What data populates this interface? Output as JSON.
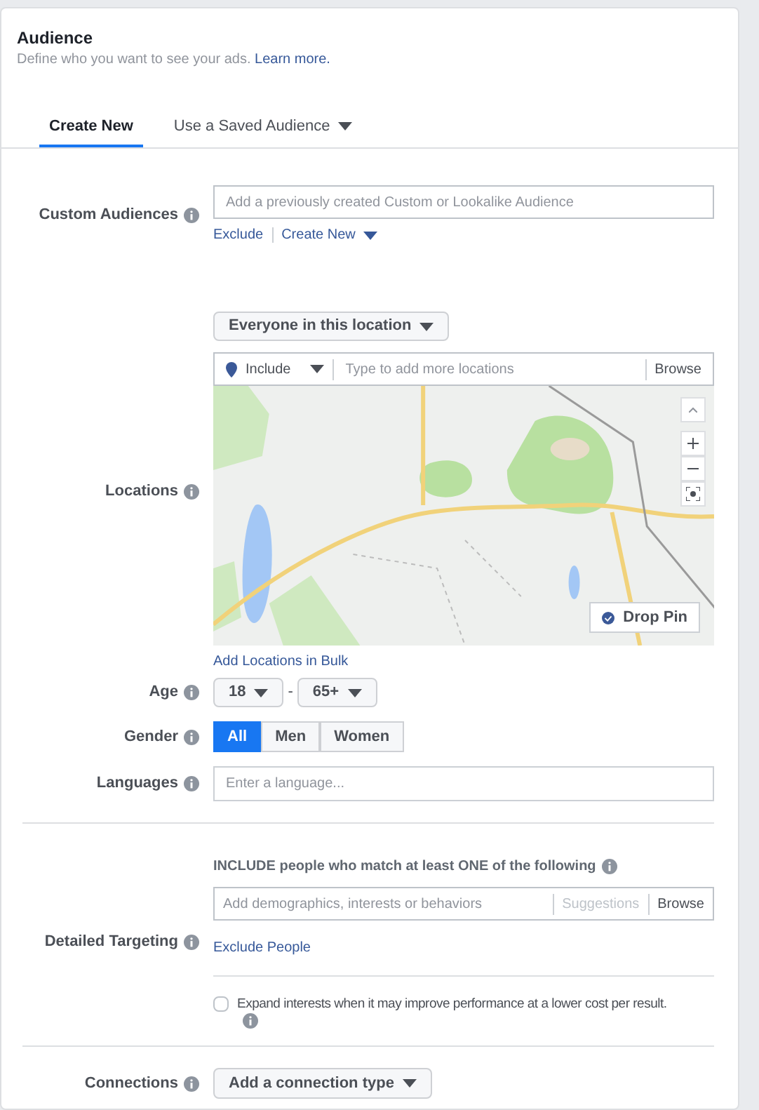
{
  "header": {
    "title": "Audience",
    "subtitle": "Define who you want to see your ads.",
    "link": "Learn more."
  },
  "tabs": [
    {
      "label": "Create New",
      "selected": true,
      "kind": "plain"
    },
    {
      "label": "Use a Saved Audience",
      "selected": false,
      "kind": "dropdown"
    }
  ],
  "custom_audiences": {
    "label": "Custom Audiences",
    "placeholder": "Add a previously created Custom or Lookalike Audience",
    "links": [
      {
        "label": "Exclude",
        "kind": "plain"
      },
      {
        "label": "Create New",
        "kind": "dropdown"
      }
    ]
  },
  "locations": {
    "label": "Locations",
    "audience_dropdown": "Everyone in this location",
    "include_dropdown": "Include",
    "placeholder": "Type to add more locations",
    "browse": "Browse",
    "drop_pin": "Drop Pin",
    "bulk_link": "Add Locations in Bulk"
  },
  "age": {
    "label": "Age",
    "min": "18",
    "separator": "-",
    "max": "65+"
  },
  "gender": {
    "label": "Gender",
    "options": [
      {
        "label": "All",
        "selected": true
      },
      {
        "label": "Men",
        "selected": false
      },
      {
        "label": "Women",
        "selected": false
      }
    ]
  },
  "languages": {
    "label": "Languages",
    "placeholder": "Enter a language..."
  },
  "detailed_targeting": {
    "label": "Detailed Targeting",
    "include_text": "INCLUDE people who match at least ONE of the following",
    "placeholder": "Add demographics, interests or behaviors",
    "suggestions": "Suggestions",
    "browse": "Browse",
    "exclude_link": "Exclude People",
    "expand": {
      "text": "Expand interests when it may improve performance at a lower cost per result.",
      "checked": false
    }
  },
  "connections": {
    "label": "Connections",
    "dropdown": "Add a connection type"
  }
}
